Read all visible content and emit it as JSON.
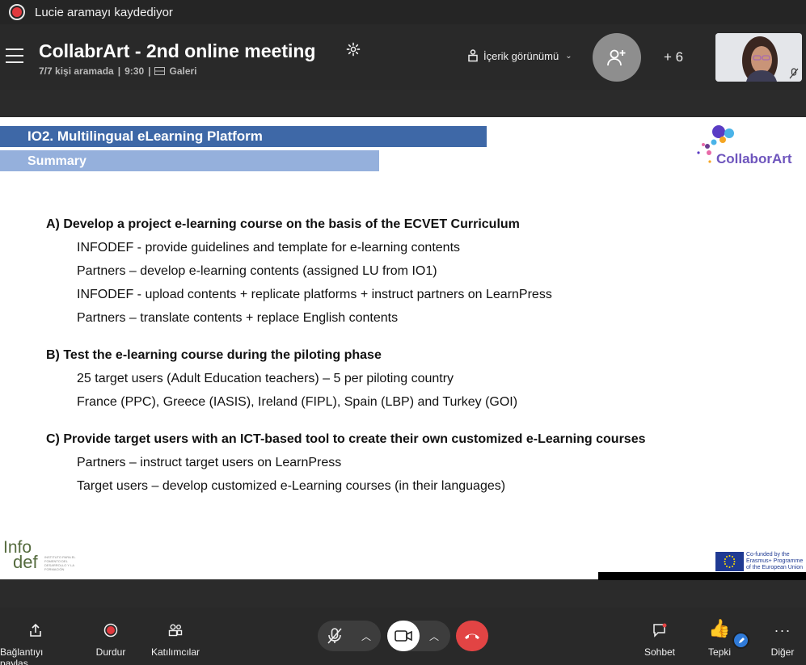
{
  "recording": {
    "text": "Lucie aramayı kaydediyor"
  },
  "header": {
    "title": "CollabrArt - 2nd online meeting",
    "meta_people": "7/7 kişi aramada",
    "meta_time": "9:30",
    "meta_view": "Galeri",
    "view_toggle": "İçerik görünümü",
    "extra_count": "+ 6"
  },
  "slide": {
    "bar1": "IO2. Multilingual eLearning Platform",
    "bar2": "Summary",
    "logo_text": "CollaborArt",
    "sections": [
      {
        "heading": "A) Develop a project e-learning course on the basis of the ECVET Curriculum",
        "items": [
          "INFODEF  - provide guidelines and template for e-learning contents",
          "Partners – develop e-learning contents (assigned LU from IO1)",
          "INFODEF  - upload contents + replicate platforms + instruct partners on LearnPress",
          "Partners – translate contents + replace English contents"
        ]
      },
      {
        "heading": "B) Test the e-learning course during the piloting phase",
        "items": [
          "25 target users (Adult Education teachers) – 5 per piloting country",
          "France (PPC), Greece (IASIS), Ireland (FIPL), Spain (LBP) and Turkey (GOI)"
        ]
      },
      {
        "heading": "C) Provide target users with an ICT-based tool to create their own customized e-Learning courses",
        "items": [
          "Partners – instruct target users on LearnPress",
          "Target users – develop customized e-Learning courses (in their languages)"
        ]
      }
    ],
    "infodef_line1": "Info",
    "infodef_line2": "def",
    "infodef_small": "INSTITUTO PARA EL FOMENTO DEL DESARROLLO Y LA FORMACIÓN",
    "eu_text": "Co-funded by the Erasmus+ Programme of the European Union"
  },
  "toolbar": {
    "share": "Bağlantıyı paylaş",
    "stop": "Durdur",
    "participants": "Katılımcılar",
    "chat": "Sohbet",
    "react": "Tepki",
    "more": "Diğer"
  }
}
